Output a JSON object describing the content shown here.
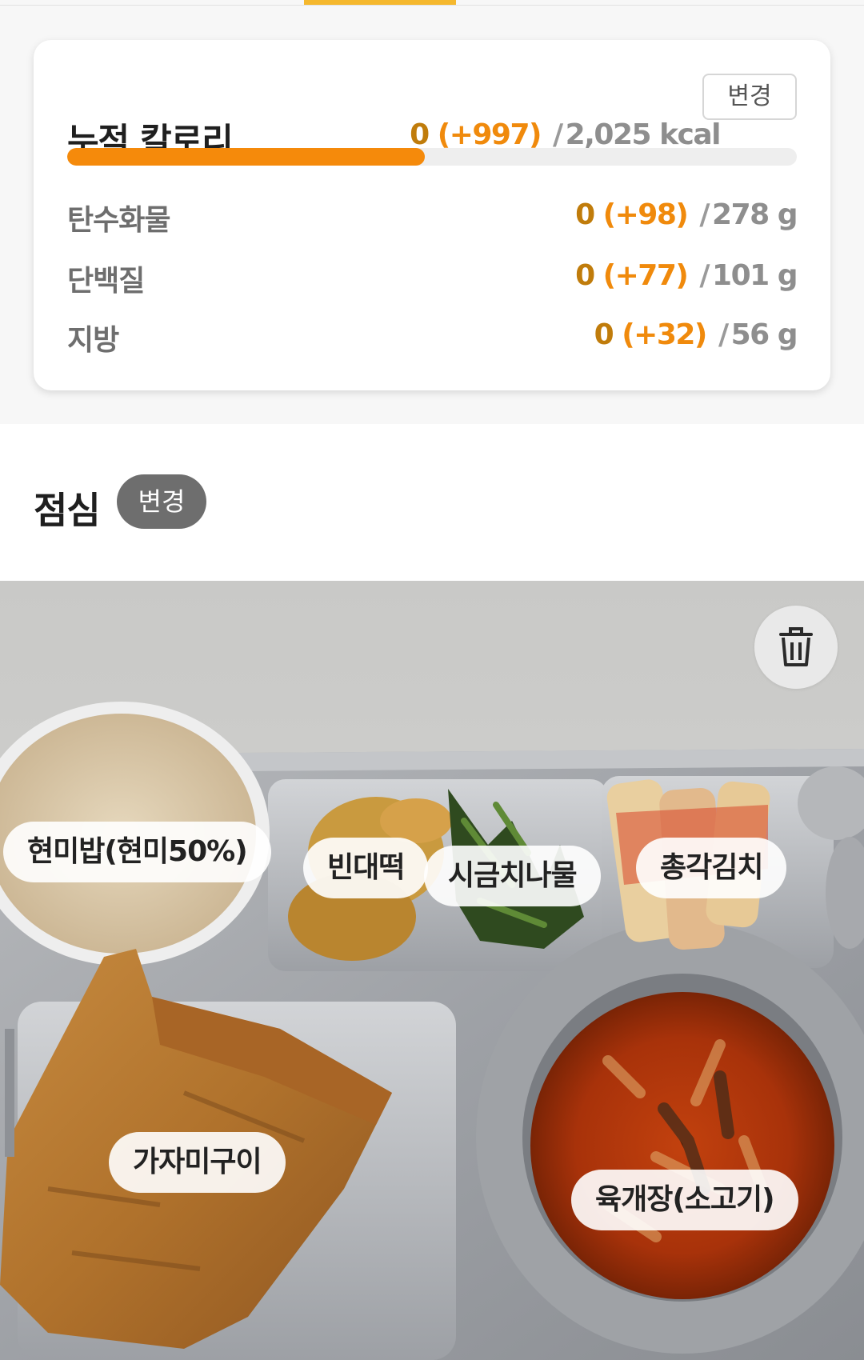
{
  "calorie_card": {
    "title": "누적 칼로리",
    "current": "0",
    "added": "(+997)",
    "separator": "/",
    "total": "2,025 kcal",
    "change_label": "변경",
    "progress_fraction": 0.49,
    "progress_color": "#f58a0b"
  },
  "macros": [
    {
      "label": "탄수화물",
      "current": "0",
      "added": "(+98)",
      "separator": "/",
      "total": "278 g"
    },
    {
      "label": "단백질",
      "current": "0",
      "added": "(+77)",
      "separator": "/",
      "total": "101 g"
    },
    {
      "label": "지방",
      "current": "0",
      "added": "(+32)",
      "separator": "/",
      "total": "56 g"
    }
  ],
  "meal": {
    "title": "점심",
    "change_label": "변경",
    "delete_icon": "trash-icon",
    "foods": [
      {
        "name": "현미밥(현미50%)"
      },
      {
        "name": "빈대떡"
      },
      {
        "name": "시금치나물"
      },
      {
        "name": "총각김치"
      },
      {
        "name": "가자미구이"
      },
      {
        "name": "육개장(소고기)"
      }
    ]
  },
  "colors": {
    "accent": "#f08a0c",
    "current_value": "#c07c0b",
    "tab_indicator": "#f5b82e"
  }
}
